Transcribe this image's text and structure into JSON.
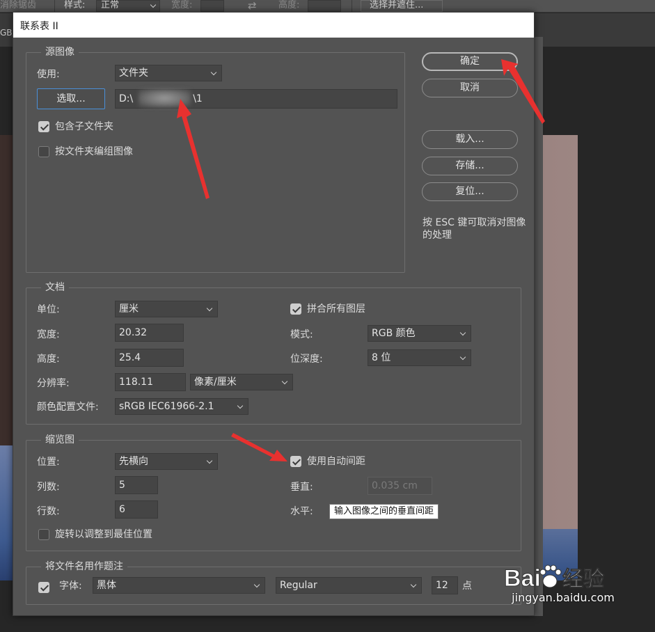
{
  "options_bar": {
    "item_antialias": "消除锯齿",
    "style_label": "样式:",
    "style_value": "正常",
    "width_label": "宽度:",
    "height_label": "高度:",
    "select_mask_button": "选择并遮住..."
  },
  "document_tab": {
    "label": "GB/"
  },
  "dialog": {
    "title": "联系表 II",
    "source": {
      "legend": "源图像",
      "use_label": "使用:",
      "use_value": "文件夹",
      "browse_button": "选取...",
      "path_prefix": "D:\\",
      "path_suffix": "\\1",
      "include_subfolders": {
        "label": "包含子文件夹",
        "checked": true
      },
      "group_by_folder": {
        "label": "按文件夹编组图像",
        "checked": false
      }
    },
    "document": {
      "legend": "文档",
      "unit_label": "单位:",
      "unit_value": "厘米",
      "width_label": "宽度:",
      "width_value": "20.32",
      "height_label": "高度:",
      "height_value": "25.4",
      "resolution_label": "分辨率:",
      "resolution_value": "118.11",
      "resolution_unit": "像素/厘米",
      "profile_label": "颜色配置文件:",
      "profile_value": "sRGB IEC61966-2.1",
      "flatten": {
        "label": "拼合所有图层",
        "checked": true
      },
      "mode_label": "模式:",
      "mode_value": "RGB 颜色",
      "depth_label": "位深度:",
      "depth_value": "8 位"
    },
    "thumbnails": {
      "legend": "缩览图",
      "place_label": "位置:",
      "place_value": "先横向",
      "columns_label": "列数:",
      "columns_value": "5",
      "rows_label": "行数:",
      "rows_value": "6",
      "rotate": {
        "label": "旋转以调整到最佳位置",
        "checked": false
      },
      "auto_spacing": {
        "label": "使用自动间距",
        "checked": true
      },
      "vertical_label": "垂直:",
      "vertical_value": "0.035 cm",
      "horizontal_label": "水平:",
      "tooltip": "输入图像之间的垂直间距"
    },
    "caption": {
      "legend": "将文件名用作题注",
      "enabled": true,
      "font_label": "字体:",
      "font_value": "黑体",
      "style_value": "Regular",
      "size_value": "12",
      "size_unit": "点"
    },
    "buttons": {
      "ok": "确定",
      "cancel": "取消",
      "load": "载入...",
      "save": "存储...",
      "reset": "复位..."
    },
    "esc_hint": "按 ESC 键可取消对图像的处理"
  },
  "annotation_color": "#e8312f",
  "watermark": {
    "brand": "Bai经验",
    "url": "jingyan.baidu.com"
  }
}
